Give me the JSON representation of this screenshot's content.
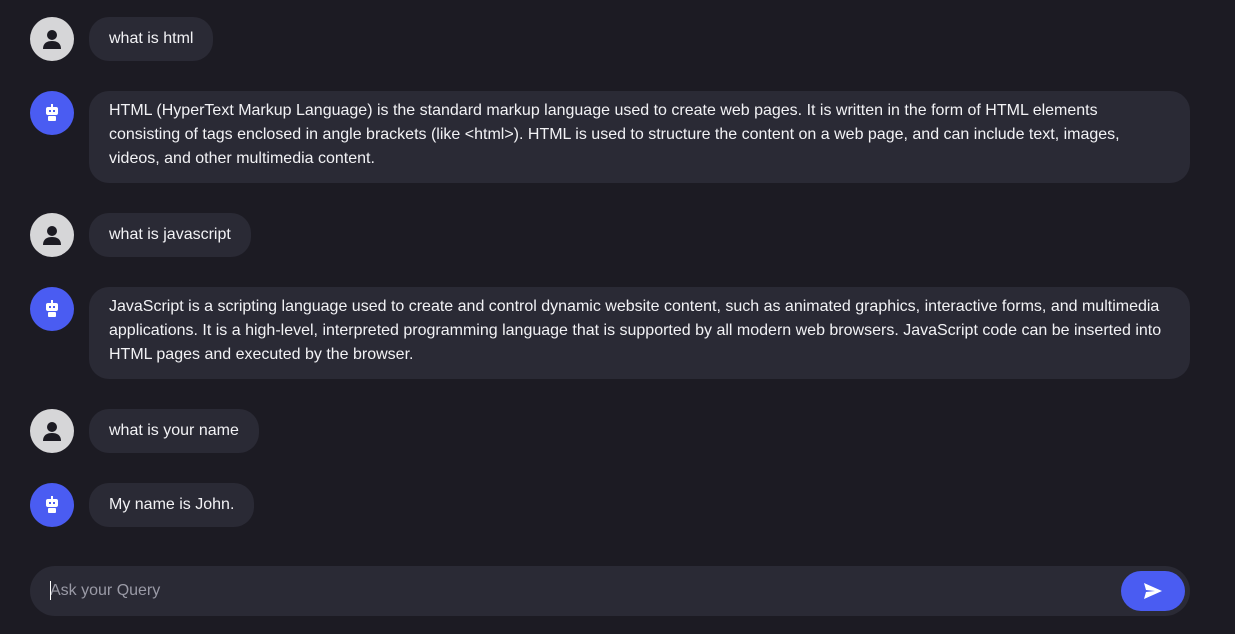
{
  "conversation": [
    {
      "role": "user",
      "avatar_icon": "user-icon",
      "text": "what is html"
    },
    {
      "role": "bot",
      "avatar_icon": "robot-icon",
      "text": "HTML (HyperText Markup Language) is the standard markup language used to create web pages. It is written in the form of HTML elements consisting of tags enclosed in angle brackets (like <html>). HTML is used to structure the content on a web page, and can include text, images, videos, and other multimedia content."
    },
    {
      "role": "user",
      "avatar_icon": "user-icon",
      "text": "what is javascript"
    },
    {
      "role": "bot",
      "avatar_icon": "robot-icon",
      "text": "JavaScript is a scripting language used to create and control dynamic website content, such as animated graphics, interactive forms, and multimedia applications. It is a high-level, interpreted programming language that is supported by all modern web browsers. JavaScript code can be inserted into HTML pages and executed by the browser."
    },
    {
      "role": "user",
      "avatar_icon": "user-icon",
      "text": "what is your name"
    },
    {
      "role": "bot",
      "avatar_icon": "robot-icon",
      "text": "My name is John."
    }
  ],
  "composer": {
    "placeholder": "Ask your Query",
    "value": "",
    "send_icon": "send-icon"
  },
  "colors": {
    "background": "#1c1b23",
    "bubble": "#2a2a35",
    "accent": "#4a5cf2",
    "user_avatar": "#d6d6d8"
  }
}
